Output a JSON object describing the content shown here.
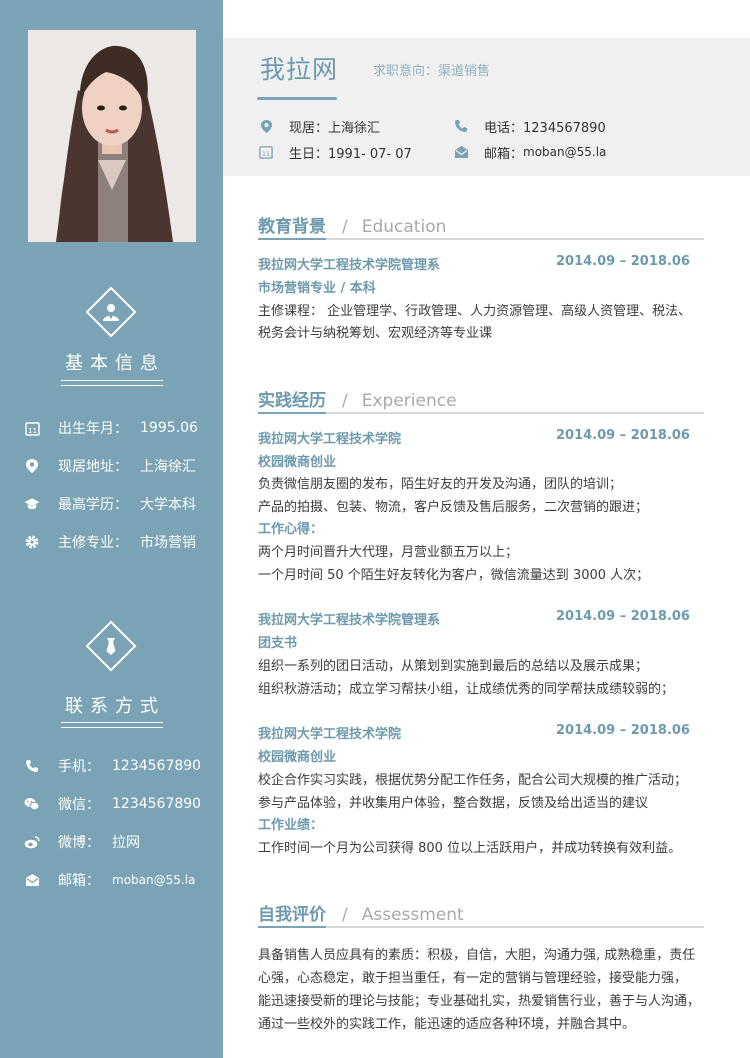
{
  "sidebar": {
    "basic_title": "基本信息",
    "basic": [
      {
        "icon": "calendar-icon",
        "label": "出生年月：",
        "value": "1995.06"
      },
      {
        "icon": "location-pin-icon",
        "label": "现居地址：",
        "value": "上海徐汇"
      },
      {
        "icon": "graduation-cap-icon",
        "label": "最高学历：",
        "value": "大学本科"
      },
      {
        "icon": "gear-icon",
        "label": "主修专业：",
        "value": "市场营销"
      }
    ],
    "contact_title": "联系方式",
    "contact": [
      {
        "icon": "phone-icon",
        "label": "手机：",
        "value": "1234567890"
      },
      {
        "icon": "wechat-icon",
        "label": "微信：",
        "value": "1234567890"
      },
      {
        "icon": "weibo-icon",
        "label": "微博：",
        "value": "拉网"
      },
      {
        "icon": "mail-icon",
        "label": "邮箱：",
        "value": "moban@55.la"
      }
    ]
  },
  "header": {
    "name": "我拉网",
    "intent": "求职意向：渠道销售",
    "residence": "现居：上海徐汇",
    "birthday": "生日：1991- 07- 07",
    "phone": "电话：1234567890",
    "email_label": "邮箱：",
    "email_value": "moban@55.la"
  },
  "education": {
    "title_cn": "教育背景",
    "title_en": "Education",
    "org": "我拉网大学工程技术学院管理系",
    "date": "2014.09 – 2018.06",
    "major": "市场营销专业 / 本科",
    "lines": [
      "主修课程： 企业管理学、行政管理、人力资源管理、高级人资管理、税法、",
      "税务会计与纳税筹划、宏观经济等专业课"
    ]
  },
  "experience": {
    "title_cn": "实践经历",
    "title_en": "Experience",
    "items": [
      {
        "org": "我拉网大学工程技术学院",
        "date": "2014.09 – 2018.06",
        "role": "校园微商创业",
        "lines": [
          "负责微信朋友圈的发布，陌生好友的开发及沟通，团队的培训；",
          "产品的拍摄、包装、物流，客户反馈及售后服务，二次营销的跟进；"
        ],
        "note_title": "工作心得：",
        "notes": [
          "两个月时间晋升大代理，月营业额五万以上；",
          "一个月时间 50 个陌生好友转化为客户，微信流量达到 3000 人次；"
        ]
      },
      {
        "org": "我拉网大学工程技术学院管理系",
        "date": "2014.09 – 2018.06",
        "role": "团支书",
        "lines": [
          "组织一系列的团日活动，从策划到实施到最后的总结以及展示成果；",
          "组织秋游活动；成立学习帮扶小组，让成绩优秀的同学帮扶成绩较弱的；"
        ]
      },
      {
        "org": "我拉网大学工程技术学院",
        "date": "2014.09 – 2018.06",
        "role": "校园微商创业",
        "lines": [
          "校企合作实习实践，根据优势分配工作任务，配合公司大规模的推广活动；",
          "参与产品体验，并收集用户体验，整合数据，反馈及给出适当的建议"
        ],
        "note_title": "工作业绩：",
        "notes": [
          "工作时间一个月为公司获得 800 位以上活跃用户，并成功转换有效利益。"
        ]
      }
    ]
  },
  "assessment": {
    "title_cn": "自我评价",
    "title_en": "Assessment",
    "lines": [
      "具备销售人员应具有的素质：积极，自信，大胆，沟通力强, 成熟稳重，责任",
      "心强，心态稳定，敢于担当重任，有一定的营销与管理经验，接受能力强，",
      "能迅速接受新的理论与技能；专业基础扎实，热爱销售行业，善于与人沟通，",
      "通过一些校外的实践工作，能迅速的适应各种环境，并融合其中。"
    ]
  },
  "colors": {
    "accent": "#7aa3b5",
    "accent_text": "#6e9aad",
    "header_bg": "#f0f0f0"
  }
}
